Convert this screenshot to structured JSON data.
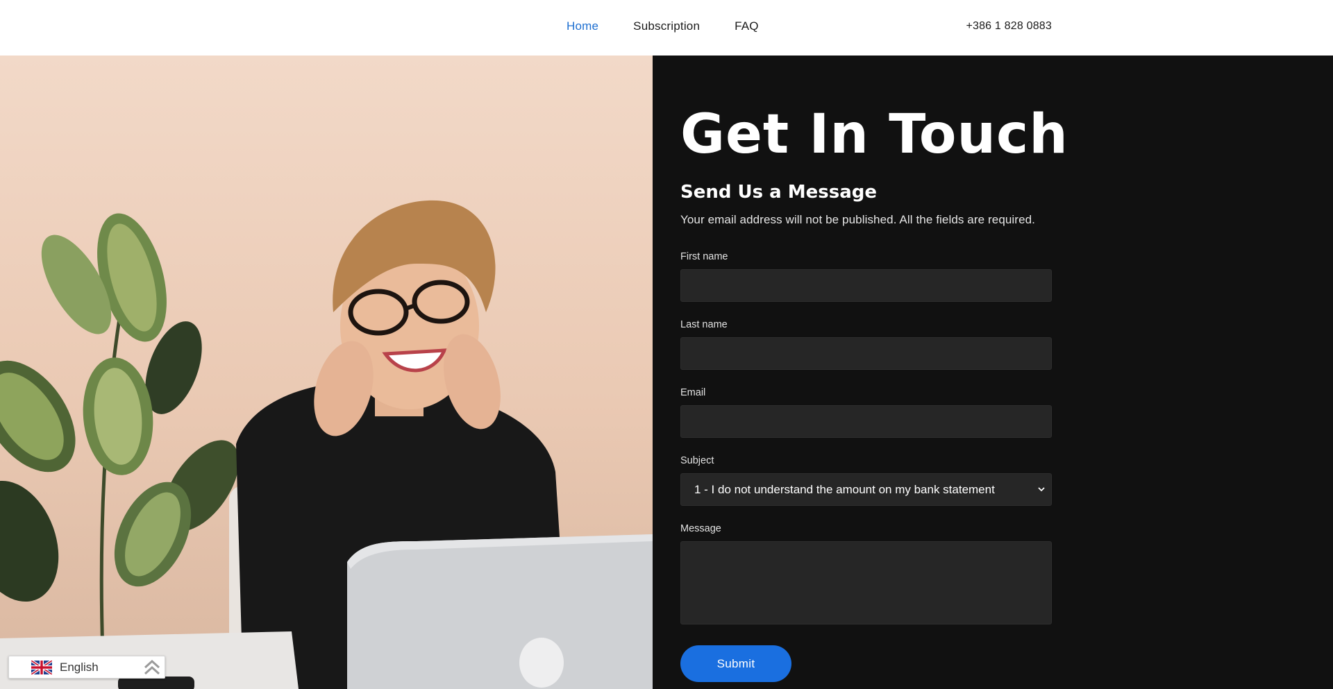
{
  "header": {
    "nav": [
      {
        "label": "Home",
        "active": true
      },
      {
        "label": "Subscription",
        "active": false
      },
      {
        "label": "FAQ",
        "active": false
      }
    ],
    "phone": "+386 1 828 0883"
  },
  "contact": {
    "title": "Get In Touch",
    "subtitle": "Send Us a Message",
    "intro": "Your email address will not be published. All the fields are required.",
    "fields": {
      "first_name": {
        "label": "First name",
        "value": ""
      },
      "last_name": {
        "label": "Last name",
        "value": ""
      },
      "email": {
        "label": "Email",
        "value": ""
      },
      "subject": {
        "label": "Subject",
        "value": "1 - I do not understand the amount on my bank statement"
      },
      "message": {
        "label": "Message",
        "value": ""
      }
    },
    "submit_label": "Submit"
  },
  "language": {
    "label": "English",
    "flag_icon": "uk-flag-icon",
    "toggle_icon": "double-chevron-up-icon"
  },
  "colors": {
    "accent": "#1e6fd1",
    "button": "#1a6fe0",
    "panel_bg": "#111111",
    "field_bg": "#262626"
  }
}
